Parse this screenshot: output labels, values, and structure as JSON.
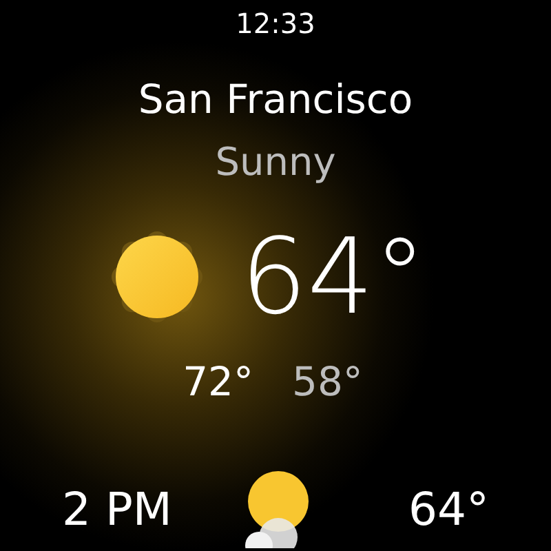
{
  "time": "12:33",
  "location": "San Francisco",
  "condition": "Sunny",
  "current": {
    "temperature": "64°",
    "high": "72°",
    "low": "58°"
  },
  "hourly": [
    {
      "time": "2 PM",
      "temperature": "64°"
    }
  ]
}
